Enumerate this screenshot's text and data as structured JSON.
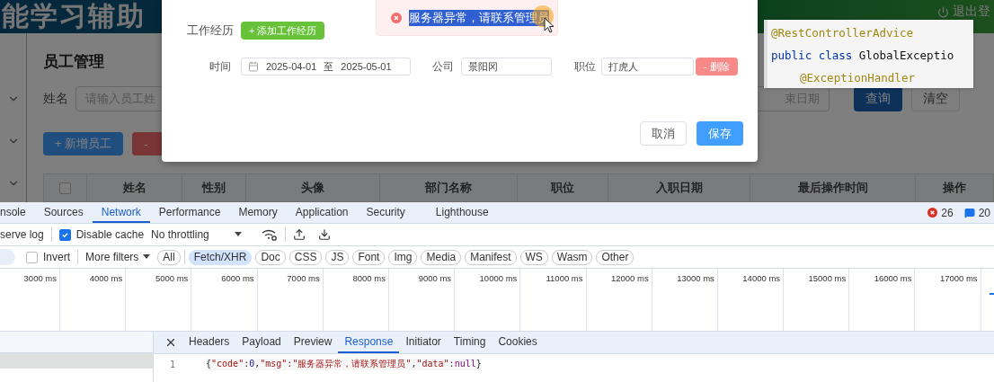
{
  "app": {
    "header": {
      "title": "能学习辅助",
      "logout": "退出登"
    },
    "page_title": "员工管理",
    "search": {
      "name_label": "姓名",
      "name_placeholder": "请输入员工姓",
      "date_placeholder": "束日期",
      "query_button": "查询",
      "clear_button": "清空"
    },
    "actions": [
      {
        "label": "+ 新增员工",
        "kind": "primary"
      },
      {
        "label": "-",
        "kind": "danger"
      }
    ],
    "table": {
      "select_all": {
        "checked": false
      },
      "columns": [
        "姓名",
        "性别",
        "头像",
        "部门名称",
        "职位",
        "入职日期",
        "最后操作时间",
        "操作"
      ]
    }
  },
  "dialog": {
    "section_label": "工作经历",
    "add_button": "+ 添加工作经历",
    "experiences": [
      {
        "time_label": "时间",
        "start": "2025-04-01",
        "separator": "至",
        "end": "2025-05-01",
        "company_label": "公司",
        "company": "景阳冈",
        "position_label": "职位",
        "position": "打虎人",
        "delete_button": "- 删除"
      }
    ],
    "buttons": [
      {
        "label": "取消",
        "kind": "default"
      },
      {
        "label": "保存",
        "kind": "primary"
      }
    ]
  },
  "toast": {
    "message": "服务器异常，请联系管理员",
    "selected": true
  },
  "code_popup": {
    "lines": [
      {
        "indented": false,
        "tokens": [
          {
            "kind": "annotation",
            "text": "@RestControllerAdvice"
          }
        ]
      },
      {
        "indented": false,
        "tokens": [
          {
            "kind": "keyword",
            "text": "public class "
          },
          {
            "kind": "plain",
            "text": "GlobalExceptio"
          }
        ]
      },
      {
        "indented": true,
        "tokens": [
          {
            "kind": "annotation",
            "text": "@ExceptionHandler"
          }
        ]
      }
    ]
  },
  "devtools": {
    "tabs": [
      {
        "label": "nsole",
        "selected": false
      },
      {
        "label": "Sources",
        "selected": false
      },
      {
        "label": "Network",
        "selected": true
      },
      {
        "label": "Performance",
        "selected": false
      },
      {
        "label": "Memory",
        "selected": false
      },
      {
        "label": "Application",
        "selected": false
      },
      {
        "label": "Security",
        "selected": false
      },
      {
        "label": "Lighthouse",
        "selected": false
      }
    ],
    "errors": "26",
    "messages": "20",
    "toolbar": {
      "preserve_log": "serve log",
      "disable_cache": {
        "label": "Disable cache",
        "checked": true
      },
      "throttling": "No throttling"
    },
    "filters": {
      "invert": {
        "label": "Invert",
        "checked": false
      },
      "more_filters": "More filters",
      "types": [
        {
          "label": "All",
          "selected": false
        },
        {
          "label": "Fetch/XHR",
          "selected": true
        },
        {
          "label": "Doc",
          "selected": false
        },
        {
          "label": "CSS",
          "selected": false
        },
        {
          "label": "JS",
          "selected": false
        },
        {
          "label": "Font",
          "selected": false
        },
        {
          "label": "Img",
          "selected": false
        },
        {
          "label": "Media",
          "selected": false
        },
        {
          "label": "Manifest",
          "selected": false
        },
        {
          "label": "WS",
          "selected": false
        },
        {
          "label": "Wasm",
          "selected": false
        },
        {
          "label": "Other",
          "selected": false
        }
      ]
    },
    "timeline": {
      "ticks": [
        "3000 ms",
        "4000 ms",
        "5000 ms",
        "6000 ms",
        "7000 ms",
        "8000 ms",
        "9000 ms",
        "10000 ms",
        "11000 ms",
        "12000 ms",
        "13000 ms",
        "14000 ms",
        "15000 ms",
        "16000 ms",
        "17000 ms"
      ]
    },
    "request_rows": [
      {
        "selected": true
      }
    ],
    "details": {
      "tabs": [
        {
          "label": "Headers",
          "selected": false
        },
        {
          "label": "Payload",
          "selected": false
        },
        {
          "label": "Preview",
          "selected": false
        },
        {
          "label": "Response",
          "selected": true
        },
        {
          "label": "Initiator",
          "selected": false
        },
        {
          "label": "Timing",
          "selected": false
        },
        {
          "label": "Cookies",
          "selected": false
        }
      ],
      "response": {
        "line_number": "1",
        "tokens": [
          {
            "kind": "punct",
            "text": "{"
          },
          {
            "kind": "key",
            "text": "\"code\""
          },
          {
            "kind": "punct",
            "text": ":"
          },
          {
            "kind": "number",
            "text": "0"
          },
          {
            "kind": "punct",
            "text": ","
          },
          {
            "kind": "key",
            "text": "\"msg\""
          },
          {
            "kind": "punct",
            "text": ":"
          },
          {
            "kind": "string",
            "text": "\"服务器异常，请联系管理员\""
          },
          {
            "kind": "punct",
            "text": ","
          },
          {
            "kind": "key",
            "text": "\"data\""
          },
          {
            "kind": "punct",
            "text": ":"
          },
          {
            "kind": "null",
            "text": "null"
          },
          {
            "kind": "punct",
            "text": "}"
          }
        ]
      }
    }
  }
}
